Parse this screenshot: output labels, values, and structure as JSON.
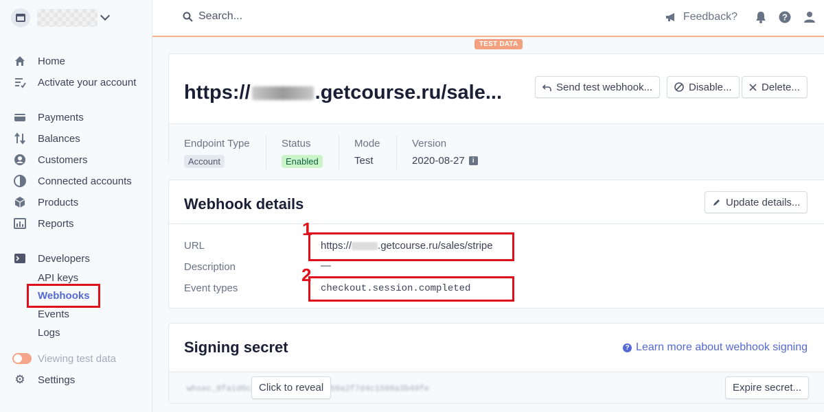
{
  "sidebar": {
    "items": [
      {
        "label": "Home",
        "icon": "home-icon"
      },
      {
        "label": "Activate your account",
        "icon": "checklist-icon"
      },
      {
        "label": "Payments",
        "icon": "payments-icon"
      },
      {
        "label": "Balances",
        "icon": "balances-icon"
      },
      {
        "label": "Customers",
        "icon": "customers-icon"
      },
      {
        "label": "Connected accounts",
        "icon": "connected-accounts-icon"
      },
      {
        "label": "Products",
        "icon": "products-icon"
      },
      {
        "label": "Reports",
        "icon": "reports-icon"
      },
      {
        "label": "Developers",
        "icon": "terminal-icon"
      }
    ],
    "dev_items": [
      "API keys",
      "Webhooks",
      "Events",
      "Logs"
    ],
    "viewing_test_data": "Viewing test data",
    "settings": "Settings"
  },
  "topbar": {
    "search_placeholder": "Search...",
    "feedback": "Feedback?",
    "test_badge": "TEST DATA"
  },
  "endpoint": {
    "url_prefix": "https://",
    "url_suffix": ".getcourse.ru/sale...",
    "buttons": {
      "send_test": "Send test webhook...",
      "disable": "Disable...",
      "delete": "Delete..."
    },
    "meta": {
      "endpoint_type_label": "Endpoint Type",
      "endpoint_type_value": "Account",
      "status_label": "Status",
      "status_value": "Enabled",
      "mode_label": "Mode",
      "mode_value": "Test",
      "version_label": "Version",
      "version_value": "2020-08-27"
    }
  },
  "details": {
    "title": "Webhook details",
    "update_button": "Update details...",
    "url_label": "URL",
    "url_prefix": "https://",
    "url_suffix": ".getcourse.ru/sales/stripe",
    "description_label": "Description",
    "description_value": "—",
    "event_types_label": "Event types",
    "event_types_value": "checkout.session.completed",
    "annotation_1": "1",
    "annotation_2": "2"
  },
  "signing": {
    "title": "Signing secret",
    "learn_more": "Learn more about webhook signing",
    "reveal_button": "Click to reveal",
    "expire_button": "Expire secret...",
    "masked": "whsec_8fa1d0c2e7b94f3a6d1c5e0b9a2f7d4c1598a3b49fe"
  },
  "colors": {
    "accent": "#5469d4",
    "annotation_red": "#e0101a",
    "test_orange": "#f3a07f",
    "status_green_bg": "#cbf4c9"
  }
}
